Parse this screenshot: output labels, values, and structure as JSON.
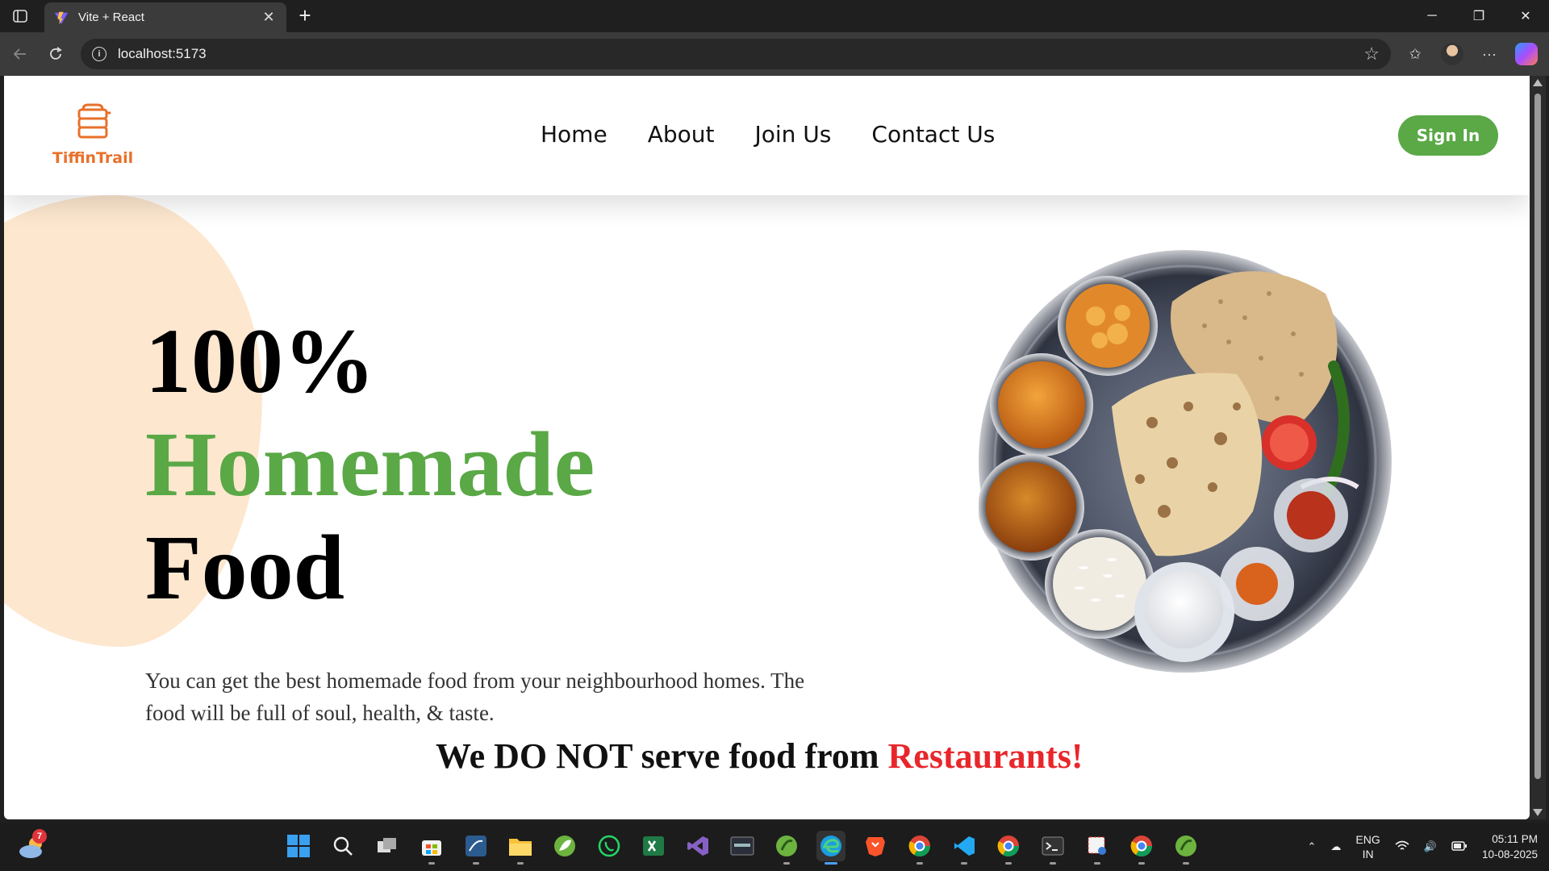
{
  "browser": {
    "tab_title": "Vite + React",
    "url": "localhost:5173"
  },
  "site": {
    "logo_text": "TiffinTrail",
    "nav": [
      "Home",
      "About",
      "Join Us",
      "Contact Us"
    ],
    "signin_label": "Sign In"
  },
  "hero": {
    "line1": "100%",
    "line2": "Homemade",
    "line3": "Food",
    "description": "You can get the best homemade food from your neighbourhood homes. The food will be full of soul, health, & taste.",
    "tagline_main": "We DO NOT serve food from ",
    "tagline_highlight": "Restaurants!"
  },
  "taskbar": {
    "weather_badge": "7",
    "lang_line1": "ENG",
    "lang_line2": "IN",
    "time": "05:11 PM",
    "date": "10-08-2025"
  },
  "colors": {
    "brand_green": "#5aa846",
    "logo_orange": "#e8702a",
    "alert_red": "#e8272b",
    "blob_peach": "#fde7cf"
  }
}
